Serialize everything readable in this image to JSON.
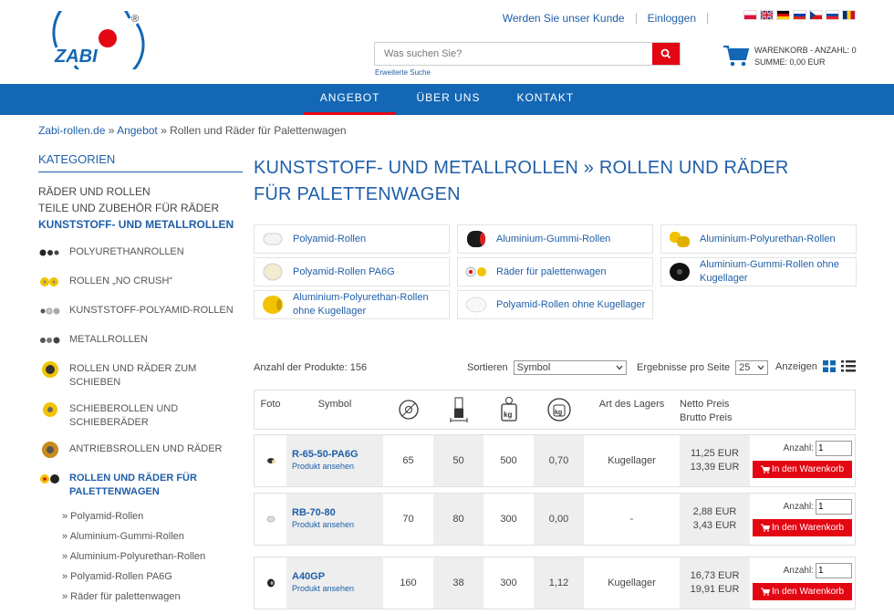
{
  "header": {
    "become_customer": "Werden Sie unser Kunde",
    "login": "Einloggen",
    "search_placeholder": "Was suchen Sie?",
    "advanced_search": "Erweiterte Suche",
    "cart_line1": "WARENKORB - ANZAHL: 0",
    "cart_line2": "SUMME: 0,00 EUR",
    "logo_text": "ZABI",
    "logo_mark": "®"
  },
  "nav": [
    {
      "label": "ANGEBOT",
      "active": true
    },
    {
      "label": "ÜBER UNS",
      "active": false
    },
    {
      "label": "KONTAKT",
      "active": false
    }
  ],
  "breadcrumb": {
    "home": "Zabi-rollen.de",
    "sep": " » ",
    "level1": "Angebot",
    "level2": "Rollen und Räder für Palettenwagen"
  },
  "sidebar": {
    "title": "KATEGORIEN",
    "top": [
      "RÄDER UND ROLLEN",
      "TEILE UND ZUBEHÖR FÜR RÄDER",
      "KUNSTSTOFF- UND METALLROLLEN"
    ],
    "sub": [
      "POLYURETHANROLLEN",
      "ROLLEN „NO CRUSH“",
      "KUNSTSTOFF-POLYAMID-ROLLEN",
      "METALLROLLEN",
      "ROLLEN UND RÄDER ZUM SCHIEBEN",
      "SCHIEBEROLLEN UND SCHIEBERÄDER",
      "ANTRIEBSROLLEN UND RÄDER",
      "ROLLEN UND RÄDER FÜR PALETTENWAGEN"
    ],
    "subsub": [
      "» Polyamid-Rollen",
      "» Aluminium-Gummi-Rollen",
      "» Aluminium-Polyurethan-Rollen",
      "» Polyamid-Rollen PA6G",
      "» Räder für palettenwagen"
    ]
  },
  "main": {
    "title_line1": "KUNSTSTOFF- UND METALLROLLEN » ROLLEN UND RÄDER",
    "title_line2": "FÜR PALETTENWAGEN",
    "cards": [
      "Polyamid-Rollen",
      "Aluminium-Gummi-Rollen",
      "Aluminium-Polyurethan-Rollen",
      "Polyamid-Rollen PA6G",
      "Räder für palettenwagen",
      "Aluminium-Gummi-Rollen ohne Kugellager",
      "Aluminium-Polyurethan-Rollen ohne Kugellager",
      "Polyamid-Rollen ohne Kugellager"
    ]
  },
  "toolbar": {
    "count_label": "Anzahl der Produkte: 156",
    "sort_label": "Sortieren",
    "sort_value": "Symbol",
    "perpage_label": "Ergebnisse pro Seite",
    "perpage_value": "25",
    "view_label": "Anzeigen"
  },
  "table": {
    "headers": {
      "foto": "Foto",
      "symbol": "Symbol",
      "lager": "Art des Lagers",
      "netto": "Netto Preis",
      "brutto": "Brutto Preis"
    },
    "qty_label": "Anzahl:",
    "add_label": "In den Warenkorb",
    "view_label": "Produkt ansehen",
    "rows": [
      {
        "code": "R-65-50-PA6G",
        "d": "65",
        "w": "50",
        "load": "500",
        "weight": "0,70",
        "lager": "Kugellager",
        "netto": "11,25 EUR",
        "brutto": "13,39 EUR",
        "qty": "1"
      },
      {
        "code": "RB-70-80",
        "d": "70",
        "w": "80",
        "load": "300",
        "weight": "0,00",
        "lager": "-",
        "netto": "2,88 EUR",
        "brutto": "3,43 EUR",
        "qty": "1"
      },
      {
        "code": "A40GP",
        "d": "160",
        "w": "38",
        "load": "300",
        "weight": "1,12",
        "lager": "Kugellager",
        "netto": "16,73 EUR",
        "brutto": "19,91 EUR",
        "qty": "1"
      }
    ]
  },
  "colors": {
    "brand_blue": "#1367b4",
    "link_blue": "#1f5fa8",
    "accent_red": "#e30613"
  }
}
